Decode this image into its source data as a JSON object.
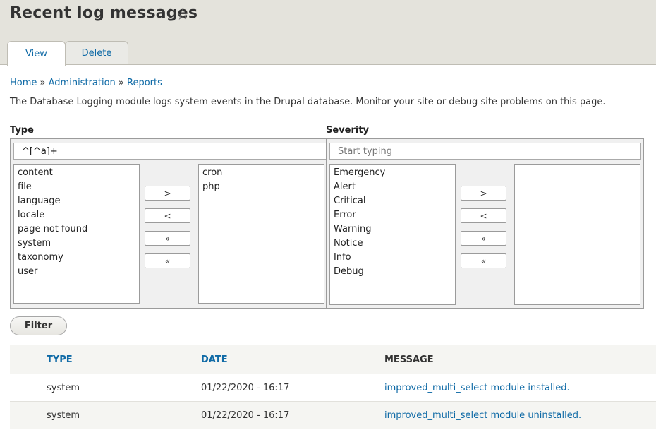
{
  "header": {
    "title": "Recent log messages",
    "star_glyph": "☆",
    "tabs": [
      {
        "label": "View",
        "active": true
      },
      {
        "label": "Delete",
        "active": false
      }
    ]
  },
  "breadcrumb": {
    "items": [
      "Home",
      "Administration",
      "Reports"
    ],
    "separator": "»"
  },
  "description": "The Database Logging module logs system events in the Drupal database. Monitor your site or debug site problems on this page.",
  "filters": {
    "type": {
      "label": "Type",
      "search_value": "^[^a]+",
      "available": [
        "content",
        "file",
        "language",
        "locale",
        "page not found",
        "system",
        "taxonomy",
        "user"
      ],
      "selected": [
        "cron",
        "php"
      ]
    },
    "severity": {
      "label": "Severity",
      "search_placeholder": "Start typing",
      "available": [
        "Emergency",
        "Alert",
        "Critical",
        "Error",
        "Warning",
        "Notice",
        "Info",
        "Debug"
      ],
      "selected": []
    },
    "buttons": {
      "add": ">",
      "remove": "<",
      "add_all": "»",
      "remove_all": "«"
    },
    "filter_button": "Filter"
  },
  "table": {
    "headers": {
      "type": "TYPE",
      "date": "DATE",
      "message": "MESSAGE"
    },
    "rows": [
      {
        "type": "system",
        "date": "01/22/2020 - 16:17",
        "message": "improved_multi_select module installed."
      },
      {
        "type": "system",
        "date": "01/22/2020 - 16:17",
        "message": "improved_multi_select module uninstalled."
      }
    ]
  },
  "colors": {
    "header_bg": "#e4e3dc",
    "link": "#0f6aa6"
  }
}
